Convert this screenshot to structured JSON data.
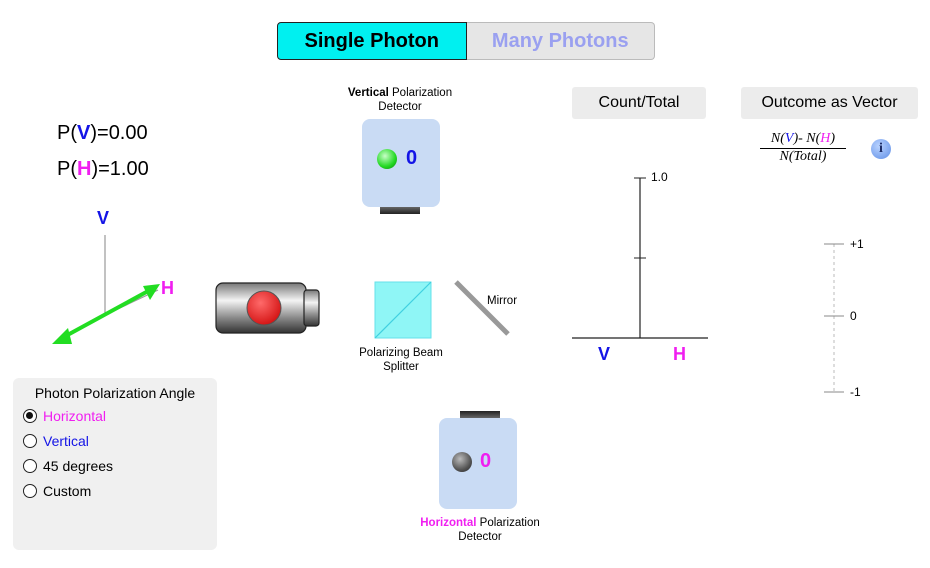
{
  "mode_toggle": {
    "single_label": "Single Photon",
    "many_label": "Many Photons",
    "selected": "Single Photon"
  },
  "probabilities": {
    "v_prefix": "P(",
    "v_letter": "V",
    "v_suffix": ")=",
    "v_value": "0.00",
    "h_prefix": "P(",
    "h_letter": "H",
    "h_suffix": ")=",
    "h_value": "1.00"
  },
  "axes_diagram": {
    "v_label": "V",
    "h_label": "H"
  },
  "vertical_detector": {
    "label_bold": "Vertical",
    "label_rest": " Polarization",
    "label_line2": "Detector",
    "count": "0"
  },
  "horizontal_detector": {
    "label_bold": "Horizontal",
    "label_rest": " Polarization",
    "label_line2": "Detector",
    "count": "0"
  },
  "beam_splitter": {
    "label_line1": "Polarizing Beam",
    "label_line2": "Splitter"
  },
  "mirror": {
    "label": "Mirror"
  },
  "count_panel": {
    "title": "Count/Total",
    "tick_top": "1.0",
    "x_v": "V",
    "x_h": "H"
  },
  "vector_panel": {
    "title": "Outcome as Vector",
    "formula_num_a": "N(",
    "formula_num_v": "V",
    "formula_num_b": ")- N(",
    "formula_num_h": "H",
    "formula_num_c": ")",
    "formula_den": "N(Total)",
    "info_icon": "i",
    "tick_plus": "+1",
    "tick_zero": "0",
    "tick_minus": "-1"
  },
  "angle_panel": {
    "title": "Photon Polarization Angle",
    "options": [
      "Horizontal",
      "Vertical",
      "45 degrees",
      "Custom"
    ],
    "selected": "Horizontal"
  },
  "colors": {
    "vertical": "#1414e6",
    "horizontal": "#f01ef0",
    "accent": "#00f0f0",
    "polarization_arrow": "#22dd22"
  }
}
